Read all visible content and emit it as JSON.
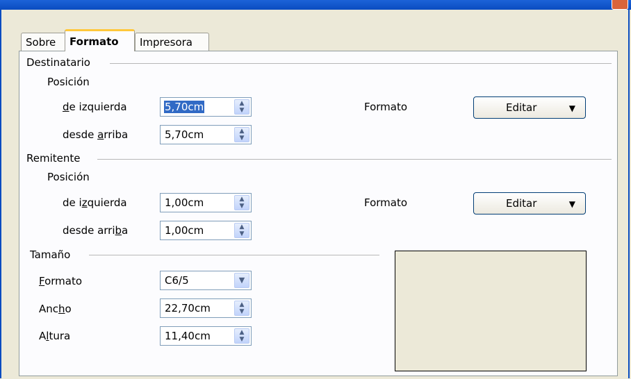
{
  "tabs": [
    "Sobre",
    "Formato",
    "Impresora"
  ],
  "destinatario": {
    "heading": "Destinatario",
    "position_label": "Posición",
    "left_label": [
      "d",
      "e izquierda"
    ],
    "left_value": "5,70cm",
    "top_label": [
      "desde ",
      "a",
      "rriba"
    ],
    "top_value": "5,70cm",
    "format_label": "Formato",
    "edit_label": "Editar"
  },
  "remitente": {
    "heading": "Remitente",
    "position_label": "Posición",
    "left_label": [
      "de i",
      "z",
      "quierda"
    ],
    "left_value": "1,00cm",
    "top_label": [
      "desde arri",
      "b",
      "a"
    ],
    "top_value": "1,00cm",
    "format_label": "Formato",
    "edit_label": "Editar"
  },
  "tamano": {
    "heading": "Tamaño",
    "format_label": [
      "",
      "F",
      "ormato"
    ],
    "format_value": "C6/5",
    "width_label": [
      "Anc",
      "h",
      "o"
    ],
    "width_value": "22,70cm",
    "height_label": [
      "A",
      "l",
      "tura"
    ],
    "height_value": "11,40cm"
  },
  "icons": {
    "spin": "spin-updown-icon",
    "combo": "chevron-down-icon",
    "menu": "triangle-down-icon"
  }
}
